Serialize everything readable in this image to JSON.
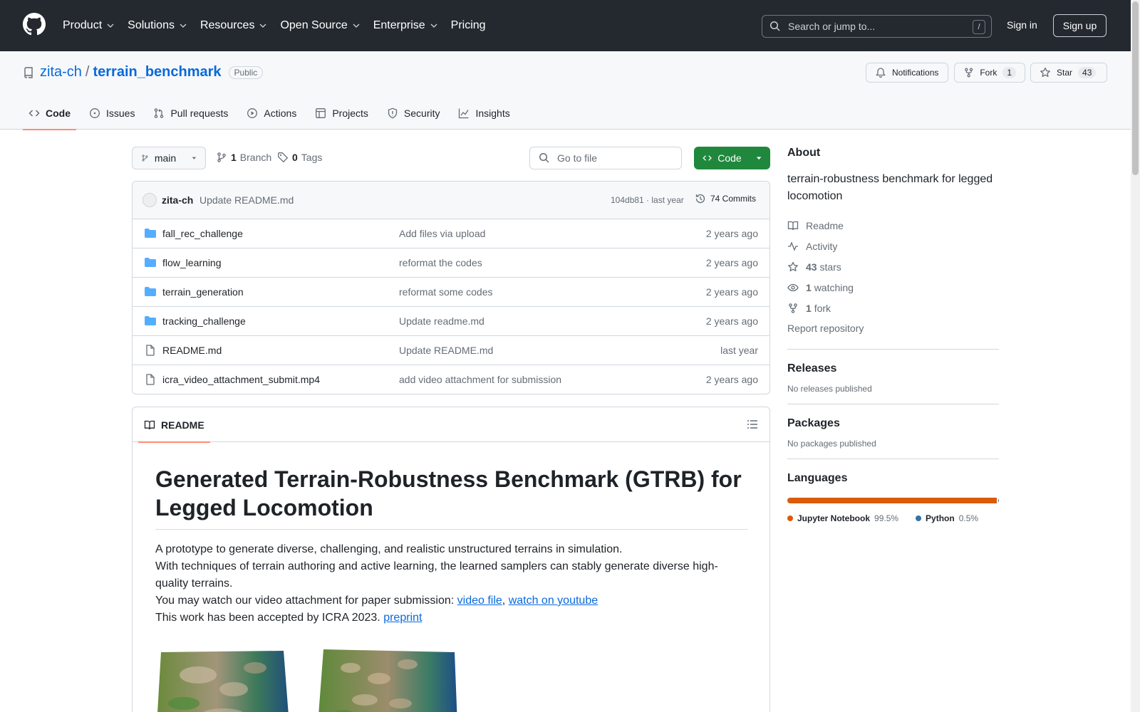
{
  "header": {
    "nav": [
      "Product",
      "Solutions",
      "Resources",
      "Open Source",
      "Enterprise",
      "Pricing"
    ],
    "search_placeholder": "Search or jump to...",
    "search_shortcut": "/",
    "signin": "Sign in",
    "signup": "Sign up"
  },
  "repo": {
    "owner": "zita-ch",
    "separator": "/",
    "name": "terrain_benchmark",
    "visibility": "Public",
    "notifications_label": "Notifications",
    "fork_label": "Fork",
    "fork_count": "1",
    "star_label": "Star",
    "star_count": "43",
    "tabs": [
      "Code",
      "Issues",
      "Pull requests",
      "Actions",
      "Projects",
      "Security",
      "Insights"
    ]
  },
  "branchbar": {
    "branch": "main",
    "branch_count": "1",
    "branch_label": "Branch",
    "tag_count": "0",
    "tag_label": "Tags",
    "goto_placeholder": "Go to file",
    "code_button": "Code"
  },
  "latest_commit": {
    "author": "zita-ch",
    "message": "Update README.md",
    "sha_time": "104db81 · last year",
    "commits": "74 Commits"
  },
  "files": [
    {
      "name": "fall_rec_challenge",
      "type": "dir",
      "message": "Add files via upload",
      "date": "2 years ago"
    },
    {
      "name": "flow_learning",
      "type": "dir",
      "message": "reformat the codes",
      "date": "2 years ago"
    },
    {
      "name": "terrain_generation",
      "type": "dir",
      "message": "reformat some codes",
      "date": "2 years ago"
    },
    {
      "name": "tracking_challenge",
      "type": "dir",
      "message": "Update readme.md",
      "date": "2 years ago"
    },
    {
      "name": "README.md",
      "type": "file",
      "message": "Update README.md",
      "date": "last year"
    },
    {
      "name": "icra_video_attachment_submit.mp4",
      "type": "file",
      "message": "add video attachment for submission",
      "date": "2 years ago"
    }
  ],
  "readme": {
    "tab_label": "README",
    "title": "Generated Terrain-Robustness Benchmark (GTRB) for Legged Locomotion",
    "line1": "A prototype to generate diverse, challenging, and realistic unstructured terrains in simulation.",
    "line2": "With techniques of terrain authoring and active learning, the learned samplers can stably generate diverse high-quality terrains.",
    "line3_prefix": "You may watch our video attachment for paper submission: ",
    "link_video": "video file",
    "comma": ", ",
    "link_youtube": "watch on youtube",
    "line4_prefix": "This work has been accepted by ICRA 2023. ",
    "link_preprint": "preprint"
  },
  "about": {
    "heading": "About",
    "description": "terrain-robustness benchmark for legged locomotion",
    "readme": "Readme",
    "activity": "Activity",
    "stars_count": "43",
    "stars_label": "stars",
    "watching_count": "1",
    "watching_label": "watching",
    "fork_count": "1",
    "fork_label": "fork",
    "report": "Report repository"
  },
  "releases": {
    "heading": "Releases",
    "text": "No releases published"
  },
  "packages": {
    "heading": "Packages",
    "text": "No packages published"
  },
  "languages": {
    "heading": "Languages",
    "items": [
      {
        "name": "Jupyter Notebook",
        "percent": "99.5%",
        "value": 99.5,
        "color": "#DA5B0B"
      },
      {
        "name": "Python",
        "percent": "0.5%",
        "value": 0.5,
        "color": "#3572A5"
      }
    ]
  },
  "colors": {
    "header_bg": "#24292f",
    "link": "#0969da",
    "code_button": "#1f883d",
    "active_tab_underline": "#fd8c73",
    "folder_icon": "#54aeff"
  }
}
